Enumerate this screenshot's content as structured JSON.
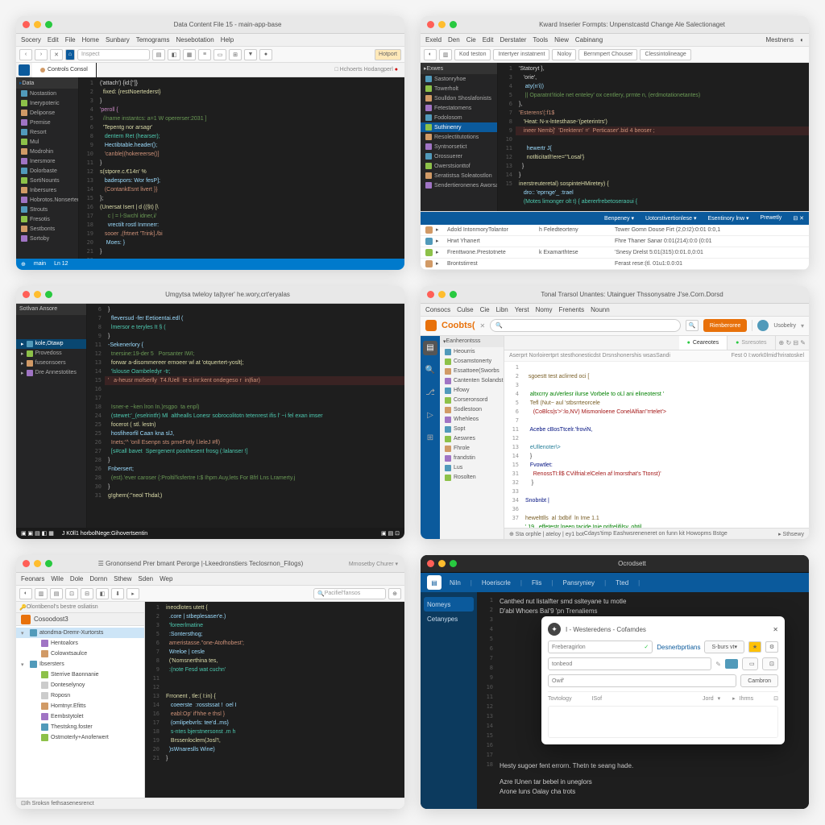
{
  "w1": {
    "title": "Data Content File 15 - main-app-base",
    "menu": [
      "Socery",
      "Edit",
      "File",
      "Home",
      "Sunbary",
      "Temograms",
      "Nesebotation",
      "Help"
    ],
    "search": "Inspect",
    "badge": "Hotport",
    "tab": "Controls Consol",
    "sidebar_hdr": "Data",
    "sidebar": [
      "Nostastion",
      "Inerypoteric",
      "Deliponse",
      "Premise",
      "Resort",
      "Mul",
      "Modrohin",
      "Inersmore",
      "Dolorbaste",
      "SortiNounts",
      "Inbersures",
      "Hobrotos.Nonserters",
      "Strouts",
      "Fresotis",
      "Sestbonts",
      "Sortoby"
    ],
    "lines": [
      "1",
      "2",
      "3",
      "4",
      "5",
      "6",
      "8",
      "9",
      "10",
      "11",
      "12",
      "13",
      "14",
      "15",
      "16",
      "17",
      "18",
      "19",
      "20",
      "21",
      "22"
    ],
    "code": [
      {
        "t": "plain",
        "s": "('attach') {id:['']}"
      },
      {
        "t": "fn",
        "s": "  fixed: {restNoertederst}"
      },
      {
        "t": "plain",
        "s": "}"
      },
      {
        "t": "kw",
        "s": "'peroll {"
      },
      {
        "t": "com",
        "s": "  //name instantcs: a=1 W opererser:2031 ]"
      },
      {
        "t": "fn",
        "s": "  'Tepentg nor arsagr'"
      },
      {
        "t": "typ",
        "s": "   dentern Ret (hearser);"
      },
      {
        "t": "var",
        "s": "   Hectibtable.header();"
      },
      {
        "t": "str",
        "s": "   'canble|(hokereerse()]"
      },
      {
        "t": "plain",
        "s": "}"
      },
      {
        "t": "fn",
        "s": "s(stpore.c.€14n' %"
      },
      {
        "t": "var",
        "s": "   badespors: Wor fesP];"
      },
      {
        "t": "str",
        "s": "   (ContankEsnt livert }}"
      },
      {
        "t": "plain",
        "s": "};"
      },
      {
        "t": "fn",
        "s": "(Unersat Isert | d ((§t) [\\"
      },
      {
        "t": "com",
        "s": "     c | = l-Swchl idner,i/"
      },
      {
        "t": "var",
        "s": "     vrectilt rostl Inmnerr:"
      },
      {
        "t": "str",
        "s": "   sooer ,(frtnert 'Trink]./bi"
      },
      {
        "t": "var",
        "s": "    Moes: }"
      },
      {
        "t": "plain",
        "s": "}"
      }
    ],
    "status": [
      "⊕",
      "main",
      "Ln 12"
    ]
  },
  "w2": {
    "title": "Kward Inserier Formpts: Unpenstcastd Change Ale Salectionaget",
    "menu": [
      "Exeld",
      "Den",
      "Cie",
      "Edit",
      "Derstater",
      "Tools",
      "Niew",
      "Cabinang"
    ],
    "toolbar_items": [
      "Kod teston",
      "Intertyer instatnent",
      "Noloy",
      "Bernmpert Chouser",
      "Clessintolineage"
    ],
    "right_badge": "Mestnens",
    "sidebar_hdr": "Exwes",
    "sidebar": [
      "Sastonryhoe",
      "Towerholt",
      "Soulldon Shoslafonists",
      "Fetestatomens",
      "Fodolosom",
      "Suthinenry",
      "Resolectitutotions",
      "Syntnorsetict",
      "Orossuerer",
      "Owerstsionttof",
      "Seratistsa Soleatostlon",
      "Sendertieronenes Aworsaneer"
    ],
    "sel_idx": 5,
    "lines": [
      "1",
      "3",
      "4",
      "5",
      "6",
      "7",
      "8",
      "9",
      "10",
      "11",
      "12",
      "13",
      "14",
      "15"
    ],
    "code": [
      {
        "t": "plain",
        "s": "'Statoryt },"
      },
      {
        "t": "plain",
        "s": "   'orie',"
      },
      {
        "t": "var",
        "s": "    aty(n'i))"
      },
      {
        "t": "com",
        "s": "    || Oparatnt'itiole net enteley' ox centlery, prmte n, (erdmotationetantes)"
      },
      {
        "t": "plain",
        "s": "},"
      },
      {
        "t": "str",
        "s": "'Esterens'(:f1$"
      },
      {
        "t": "fn",
        "s": "   'Heat: N-x-lntesthase-'(peterintrs')"
      },
      {
        "hl": true,
        "t": "str",
        "s": "   ineer Nemb]'  'Drektenn' ='  Perticaser'.bid 4 beoser ;"
      },
      {
        "t": "var",
        "s": "     hewertr J{"
      },
      {
        "t": "fn",
        "s": "     notlticitatl!!ere='\"Losal'}"
      },
      {
        "t": "plain",
        "s": "  }"
      },
      {
        "t": "plain",
        "s": "}"
      },
      {
        "t": "fn",
        "s": "inerstreuteretal) sospinteHMiretey) {"
      },
      {
        "t": "var",
        "s": "   dro:: 'eprnge'_ :trael"
      },
      {
        "t": "typ",
        "s": "   (Motes limonger olt t) { abererfrebetoseraoui {"
      }
    ],
    "panel_tabs": [
      "Benpeney",
      "Uotorstivertionlese",
      "Esentinory lnw",
      "Prewetly"
    ],
    "panel_rows": [
      {
        "c": "#d19a66",
        "n": "Adold IntonmoryTolantor",
        "d": "h Feledteorteny",
        "t": "Tower Gomn Douse Firt (2,0:I2):0:01 0:0,1"
      },
      {
        "c": "#519aba",
        "n": "Hrwt Yhanert",
        "d": "",
        "t": "Fhre Thaner Sanar 0:01(214):0:0 (0:01"
      },
      {
        "c": "#8dc149",
        "n": "Frenttwone.Prestotnete",
        "d": "k Examarthtese",
        "t": "'Snesy  Drelst 5:01(315):0:01.0,0:01"
      },
      {
        "c": "#d19a66",
        "n": "Brontstirrest",
        "d": "",
        "t": "Ferast rese:(tl. 01u1:0.0:01"
      }
    ]
  },
  "w3": {
    "title": "Umgytsa twleloy ta|tyrer' he.wory,crt'eryalas",
    "sidebar_hdr": "Sotlvan Ansore",
    "sidebar": [
      "kole,Otawp",
      "Provedoss",
      "fuseonsoers",
      "Dre Annestotites"
    ],
    "sel_idx": 0,
    "lines": [
      "6",
      "7",
      "8",
      "9",
      "11",
      "12",
      "13",
      "14",
      "15",
      "16",
      "17",
      "18",
      "24",
      "25",
      "25",
      "26",
      "27",
      "28",
      "26",
      "28",
      "30",
      "31"
    ],
    "code": [
      {
        "t": "plain",
        "s": "}"
      },
      {
        "t": "var",
        "s": "  fleversud -fer Eetioentai.edl ("
      },
      {
        "t": "typ",
        "s": "  lmersor e teryles It § ("
      },
      {
        "t": "plain",
        "s": "}"
      },
      {
        "t": "var",
        "s": "-Sekenerlory {"
      },
      {
        "t": "com",
        "s": "  tnersine:19-der 5   Porsanter IWI;"
      },
      {
        "t": "fn",
        "s": "  forwar a-disommereer ernoeer wl at 'otquertert-yoslt|;"
      },
      {
        "t": "typ",
        "s": "  'lslouse Oambeledyr -tr;"
      },
      {
        "hl": true,
        "t": "str",
        "s": "'   a-heusr mofserlly  T4.fUell  te s inr:kent ondegeso r  in|fiar)"
      },
      {
        "t": "plain",
        "s": ""
      },
      {
        "t": "com",
        "s": "  Isner-e ~ken lron In.)rsgpo  ta enpl)"
      },
      {
        "t": "typ",
        "s": "  (stewet:'_(eselrintfr) Ml  althealls Lonesr sobrocolitotn tetenrest ifis l' ~i fel exan imser"
      },
      {
        "t": "fn",
        "s": "  focerot ( stl. lestn)"
      },
      {
        "t": "var",
        "s": "  hosfiheorfil Caan kna slJ,"
      },
      {
        "t": "str",
        "s": "  Inets;'^ 'onll Esenpn sts prneFotly l.leleJ #fl)"
      },
      {
        "t": "typ",
        "s": "  [s#call bavet  Spergenent poothesent frosg (:lalanser !]"
      },
      {
        "t": "plain",
        "s": "}"
      },
      {
        "t": "var",
        "s": "Fnbersert;"
      },
      {
        "t": "com",
        "s": "  (est).'ever caroser {:Proltil'ksfertre I:$ Ihpm Auy,lets For Bfrl Lns Lramerty.j"
      },
      {
        "t": "plain",
        "s": "}"
      },
      {
        "t": "fn",
        "s": "g!ghern(:\"neol Thdal;)"
      }
    ],
    "status": "J K0ll1  horbolNege:Gihovertsentin"
  },
  "w4": {
    "title": "Tonal Trarsol Unantes: Utainguer Thssonysatre J'se.Corn.Dorsd",
    "menu": [
      "Consocs",
      "Culse",
      "Cie",
      "Libn",
      "Yerst",
      "Nomy",
      "Frenents",
      "Nounn"
    ],
    "logo": "Coobts(",
    "url": "",
    "btn1": "Rienberoree",
    "btn2": "Usobelry",
    "sidebar_hdr": "Eanherontsss",
    "sidebar": [
      "Heourris",
      "Cosamstonerty",
      "Essattoee(Sworbs",
      "Cantenten Solandst",
      "Hfowy",
      "Corseronsord",
      "Sodlestoon",
      "Whehleos",
      "Sopt",
      "Aeswres",
      "Fhrole",
      "frandstin",
      "Lus",
      "Rosolten"
    ],
    "tabs": [
      "Ceareotes",
      "Ssresotes"
    ],
    "breadcrumb": "Aserprt Norloirertprt stesthonesticdst Drsnshonershis wsasSandi",
    "path": "Fest  0 I:work0lmid'hriratoskel",
    "lines": [
      "1",
      "2",
      "3",
      "4",
      "5",
      "6",
      "7",
      "11",
      "12",
      "13",
      "14",
      "15",
      "31",
      "32",
      "33",
      "34",
      "36",
      "37"
    ],
    "code": [
      {
        "t": "plain",
        "s": ""
      },
      {
        "t": "fn",
        "s": "  sgoestt test aclirred oci ["
      },
      {
        "t": "plain",
        "s": ""
      },
      {
        "t": "com",
        "s": "   altxcrry auVerlesr ilurse Vorbele to oLl ani elineoterst '"
      },
      {
        "t": "fn",
        "s": "   Tefl (Nut~ aul 'stbsrrteorcele"
      },
      {
        "t": "str",
        "s": "     (CoBlcs|s'>':lo,NV) Mismonloene ConelAlfian''rrtelet'>"
      },
      {
        "t": "plain",
        "s": ""
      },
      {
        "t": "var",
        "s": "   Acebe cBosTtcelr.'froviN,"
      },
      {
        "t": "plain",
        "s": ""
      },
      {
        "t": "typ",
        "s": "   eUllenoter\\>"
      },
      {
        "t": "plain",
        "s": "   }"
      },
      {
        "t": "var",
        "s": "   Fvowtlet:"
      },
      {
        "t": "str",
        "s": "     RenossTI:ll$ CVilfrial:elCelen af lmorsthat's Ttonst)'"
      },
      {
        "t": "plain",
        "s": "    }"
      },
      {
        "t": "plain",
        "s": ""
      },
      {
        "t": "var",
        "s": "Snobnbt |"
      },
      {
        "t": "plain",
        "s": ""
      },
      {
        "t": "fn",
        "s": "hewelttlls  al :bdbif  ln Ime 1.1"
      },
      {
        "t": "com",
        "s": "' 19   effetestr lneen,tacide Inie prifrelifilsy, obtil"
      }
    ],
    "status": "Cdays'timp Eashwsreneneret on funn kit Howopms Bstge"
  },
  "w5": {
    "title": "Grononsend Prer bmant Perorge |-Lkeedronstiers Teclosrnon_Filogs)",
    "menu": [
      "Feonars",
      "Wile",
      "Dole",
      "Dornn",
      "Sthew",
      "Sden",
      "Wep"
    ],
    "search": "Pacifiel'fansos",
    "sidebar_hdr": "Olontibenol's bestre osliatisn",
    "root": "Cosoodost3",
    "tree": [
      {
        "d": 0,
        "sel": true,
        "exp": true,
        "c": "#519aba",
        "n": "atondma-Dremr-Xurtorsts"
      },
      {
        "d": 1,
        "c": "#a074c4",
        "n": "Hentoalors"
      },
      {
        "d": 1,
        "c": "#d19a66",
        "n": "Colowxtsaulce"
      },
      {
        "d": 0,
        "exp": true,
        "c": "#519aba",
        "n": "Ibsersters"
      },
      {
        "d": 1,
        "c": "#8dc149",
        "n": "Sterrive Baonnanie"
      },
      {
        "d": 1,
        "n": "Donteselynoy"
      },
      {
        "d": 1,
        "n": "Roposn"
      },
      {
        "d": 1,
        "c": "#d19a66",
        "n": "Homtnyr.Efitts"
      },
      {
        "d": 1,
        "c": "#a074c4",
        "n": "Eembstytolet"
      },
      {
        "d": 1,
        "c": "#519aba",
        "n": "Thestskng.foster"
      },
      {
        "d": 1,
        "c": "#8dc149",
        "n": "Ostmoterly+Anoferwert"
      }
    ],
    "lines": [
      "1",
      "2",
      "3",
      "5",
      "6",
      "7",
      "8",
      "9",
      "11",
      "12",
      "13",
      "14",
      "16",
      "17",
      "18",
      "19",
      "20",
      "21"
    ],
    "code": [
      {
        "t": "fn",
        "s": "ineodlotes utett {"
      },
      {
        "t": "var",
        "s": "  .core | stbeplesaser'e.)"
      },
      {
        "t": "typ",
        "s": "  'foreerlmatine"
      },
      {
        "t": "var",
        "s": "  :Sontersthog;"
      },
      {
        "t": "str",
        "s": "  ameristasse.''one-Atofhobest';"
      },
      {
        "t": "var",
        "s": "  Wreloe | cesle"
      },
      {
        "t": "fn",
        "s": "  ('Nomsnerthina tes,"
      },
      {
        "t": "typ",
        "s": "  :(note Fesd wat cuchn'"
      },
      {
        "t": "plain",
        "s": ""
      },
      {
        "t": "plain",
        "s": ""
      },
      {
        "t": "fn",
        "s": "Frronent , tle:( I:in) {"
      },
      {
        "t": "var",
        "s": "   coeerste  :rosstssat !  oel I"
      },
      {
        "t": "str",
        "s": "   eabl:Op' if'hhe e thsl }"
      },
      {
        "t": "var",
        "s": "   (omlipebvrls: tee'd..ms}"
      },
      {
        "t": "typ",
        "s": "   s-ntes bjerstnersonst .m h"
      },
      {
        "t": "fn",
        "s": "   Brssenloclem(Josl'!,"
      },
      {
        "t": "var",
        "s": "  )sWnareslls Wine)"
      },
      {
        "t": "plain",
        "s": "}"
      }
    ],
    "status": "Ih Sroksn fethsasenesrenct"
  },
  "w6": {
    "title": "Ocrodsett",
    "tabs": [
      "Niln",
      "Hoeriscrle",
      "Flis",
      "Pansryniey",
      "Tted"
    ],
    "sidebar": [
      "Nomeys",
      "Cetanypes"
    ],
    "msg1": "Canthed nut listalfter smd sslteyane tu motle",
    "msg2": "D'abl Whoers Bal'9 'pn Trenaliems",
    "msg3": "Hesty sugoer fent errorn. Thetn te seang hade.",
    "msg4": "Azre IUnen tar bebel in uneglors",
    "msg5": "Arone luns Oalay cha trots",
    "dlg_title": "I - Westeredens - Cofamdes",
    "dlg_input": "Freberagirlon",
    "dlg_btn1": "Desnerbprtians",
    "dlg_btn2": "S-burs vt",
    "dlg_field1": "tonbeod",
    "dlg_field2": "Owif'",
    "dlg_btn3": "Cambron",
    "dlg_lbl1": "Tovtology",
    "dlg_lbl2": "ISof",
    "dlg_lbl3": "Jord",
    "dlg_lbl4": "Ihrms",
    "lines": [
      "1",
      "2",
      "3",
      "4",
      "5",
      "6",
      "7",
      "8",
      "9",
      "10",
      "11",
      "12",
      "13",
      "14",
      "15",
      "16",
      "17",
      "18"
    ]
  }
}
